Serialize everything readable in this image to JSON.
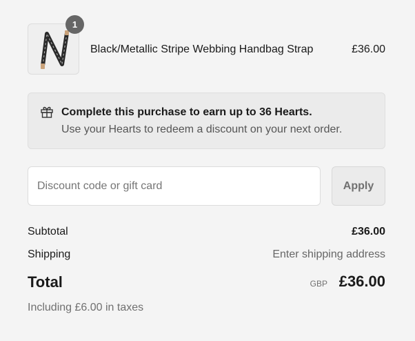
{
  "line_item": {
    "quantity": "1",
    "name": "Black/Metallic Stripe Webbing Handbag Strap",
    "price": "£36.00",
    "thumbnail_icon": "handbag-strap-image"
  },
  "hearts_banner": {
    "icon": "gift-icon",
    "title": "Complete this purchase to earn up to 36 Hearts.",
    "subtitle": "Use your Hearts to redeem a discount on your next order."
  },
  "discount": {
    "placeholder": "Discount code or gift card",
    "value": "",
    "apply_label": "Apply"
  },
  "summary": {
    "subtotal_label": "Subtotal",
    "subtotal_value": "£36.00",
    "shipping_label": "Shipping",
    "shipping_value": "Enter shipping address",
    "total_label": "Total",
    "currency": "GBP",
    "total_value": "£36.00",
    "taxes_note": "Including £6.00 in taxes"
  }
}
